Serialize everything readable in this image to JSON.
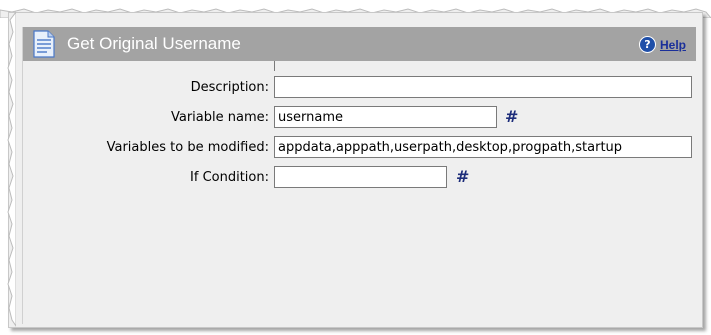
{
  "header": {
    "title": "Get Original Username",
    "help_label": "Help"
  },
  "form": {
    "description": {
      "label": "Description:",
      "value": ""
    },
    "variable_name": {
      "label": "Variable name:",
      "value": "username"
    },
    "variables_modified": {
      "label": "Variables to be modified:",
      "value": "appdata,apppath,userpath,desktop,progpath,startup"
    },
    "if_condition": {
      "label": "If Condition:",
      "value": ""
    },
    "variable_picker_symbol": "#"
  },
  "colors": {
    "titlebar": "#a3a3a3",
    "panel": "#efefef",
    "link": "#1a2f9a"
  }
}
